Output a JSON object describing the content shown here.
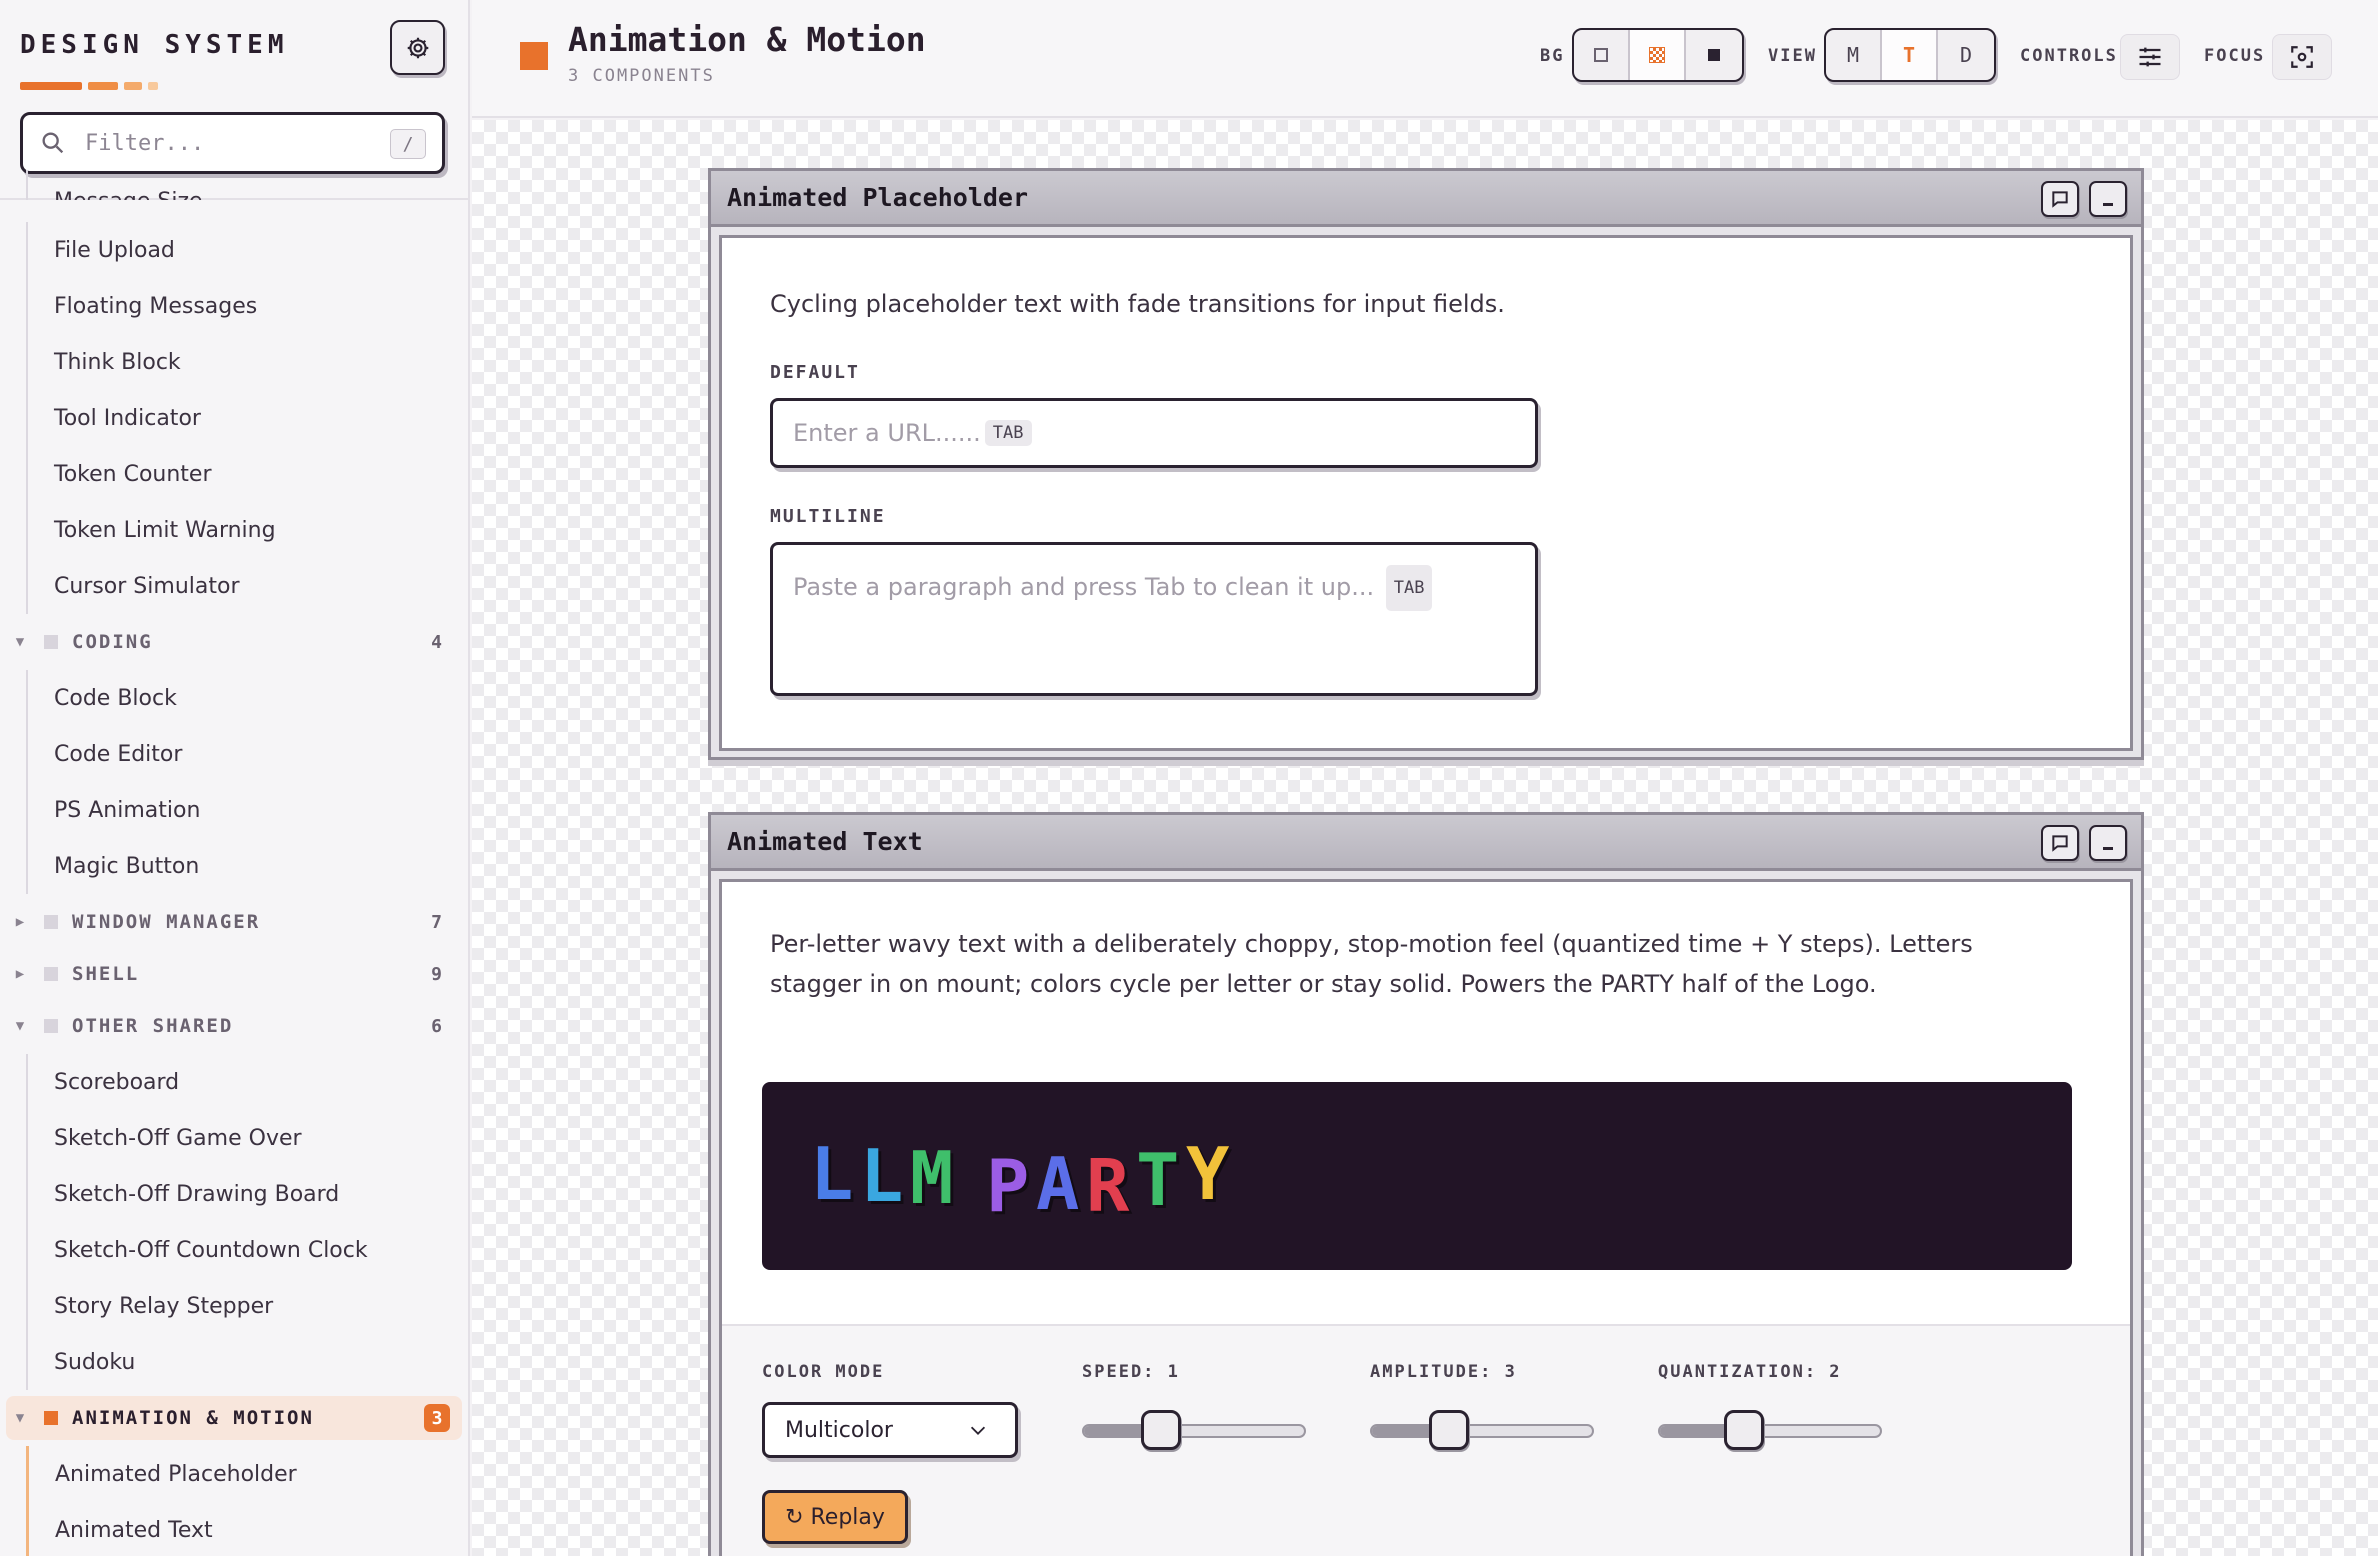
{
  "sidebar": {
    "brand": "DESIGN SYSTEM",
    "filter_placeholder": "Filter...",
    "filter_shortcut": "/",
    "partial_item": "Message Size",
    "items_top": [
      "File Upload",
      "Floating Messages",
      "Think Block",
      "Tool Indicator",
      "Token Counter",
      "Token Limit Warning",
      "Cursor Simulator"
    ],
    "cat_coding": {
      "label": "CODING",
      "count": "4"
    },
    "items_coding": [
      "Code Block",
      "Code Editor",
      "PS Animation",
      "Magic Button"
    ],
    "cat_window": {
      "label": "WINDOW MANAGER",
      "count": "7"
    },
    "cat_shell": {
      "label": "SHELL",
      "count": "9"
    },
    "cat_other": {
      "label": "OTHER SHARED",
      "count": "6"
    },
    "items_other": [
      "Scoreboard",
      "Sketch-Off Game Over",
      "Sketch-Off Drawing Board",
      "Sketch-Off Countdown Clock",
      "Story Relay Stepper",
      "Sudoku"
    ],
    "cat_anim": {
      "label": "ANIMATION & MOTION",
      "count": "3"
    },
    "items_anim": [
      "Animated Placeholder",
      "Animated Text"
    ]
  },
  "header": {
    "title": "Animation & Motion",
    "subtitle": "3 COMPONENTS",
    "bg_label": "BG",
    "view_label": "VIEW",
    "view_options": [
      "M",
      "T",
      "D"
    ],
    "controls_label": "CONTROLS",
    "focus_label": "FOCUS"
  },
  "win1": {
    "title": "Animated Placeholder",
    "desc": "Cycling placeholder text with fade transitions for input fields.",
    "default_label": "DEFAULT",
    "default_placeholder": "Enter a URL......",
    "tab_chip": "TAB",
    "multiline_label": "MULTILINE",
    "multiline_placeholder": "Paste a paragraph and press Tab to clean it up..."
  },
  "win2": {
    "title": "Animated Text",
    "desc": "Per-letter wavy text with a deliberately choppy, stop-motion feel (quantized time + Y steps). Letters stagger in on mount; colors cycle per letter or stay solid. Powers the PARTY half of the Logo.",
    "preview_letters": [
      {
        "ch": "L",
        "color": "#4a7de8"
      },
      {
        "ch": "L",
        "color": "#3aa7e0"
      },
      {
        "ch": "M",
        "color": "#3fbf6b"
      },
      {
        "ch": "P",
        "color": "#9b5de5"
      },
      {
        "ch": "A",
        "color": "#5b6ee8"
      },
      {
        "ch": "R",
        "color": "#e23f4f"
      },
      {
        "ch": "T",
        "color": "#3fbf6b"
      },
      {
        "ch": "Y",
        "color": "#f2c23a"
      }
    ],
    "color_mode_label": "COLOR MODE",
    "color_mode_value": "Multicolor",
    "speed_label": "SPEED: 1",
    "speed_value": 0.32,
    "amplitude_label": "AMPLITUDE: 3",
    "amplitude_value": 0.32,
    "quantization_label": "QUANTIZATION: 2",
    "quantization_value": 0.36,
    "replay_label": "↻ Replay"
  },
  "colors": {
    "accent": "#e8722c",
    "ink": "#2a2230"
  }
}
